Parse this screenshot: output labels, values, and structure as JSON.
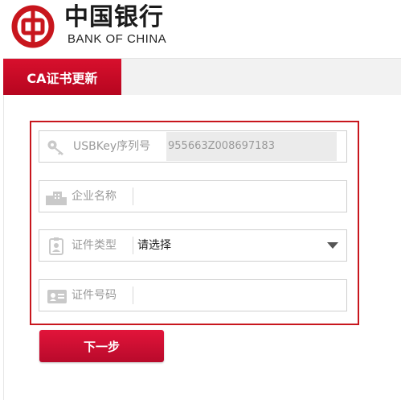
{
  "brand": {
    "name_cn": "中国银行",
    "name_en": "BANK OF CHINA",
    "color": "#c8161d"
  },
  "tabs": [
    {
      "label": "CA证书更新",
      "active": true
    }
  ],
  "form": {
    "usbkey": {
      "label": "USBKey序列号",
      "value": "955663Z008697183",
      "icon": "key-icon"
    },
    "company": {
      "label": "企业名称",
      "value": "",
      "icon": "building-icon"
    },
    "cert_type": {
      "label": "证件类型",
      "value": "请选择",
      "icon": "id-card-icon"
    },
    "cert_number": {
      "label": "证件号码",
      "value": "",
      "icon": "id-document-icon"
    }
  },
  "buttons": {
    "next": "下一步"
  },
  "colors": {
    "accent": "#d8102d",
    "highlight_border": "#c8161d",
    "field_border": "#cfcfcf"
  }
}
